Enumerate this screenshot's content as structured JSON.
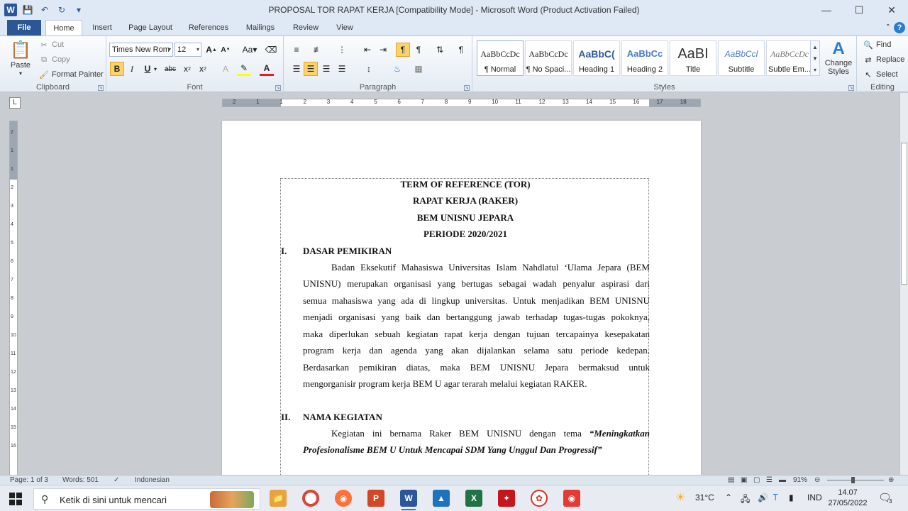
{
  "window": {
    "title": "PROPOSAL TOR RAPAT KERJA [Compatibility Mode]  -  Microsoft Word (Product Activation Failed)"
  },
  "tabs": [
    {
      "label": "File"
    },
    {
      "label": "Home"
    },
    {
      "label": "Insert"
    },
    {
      "label": "Page Layout"
    },
    {
      "label": "References"
    },
    {
      "label": "Mailings"
    },
    {
      "label": "Review"
    },
    {
      "label": "View"
    }
  ],
  "clipboard": {
    "paste": "Paste",
    "cut": "Cut",
    "copy": "Copy",
    "format_painter": "Format Painter",
    "label": "Clipboard"
  },
  "font": {
    "family": "Times New Rom",
    "size": "12",
    "label": "Font"
  },
  "paragraph": {
    "label": "Paragraph"
  },
  "styles": {
    "items": [
      {
        "preview": "AaBbCcDc",
        "name": "¶ Normal"
      },
      {
        "preview": "AaBbCcDc",
        "name": "¶ No Spaci..."
      },
      {
        "preview": "AaBbC(",
        "name": "Heading 1"
      },
      {
        "preview": "AaBbCc",
        "name": "Heading 2"
      },
      {
        "preview": "AaBI",
        "name": "Title"
      },
      {
        "preview": "AaBbCcl",
        "name": "Subtitle"
      },
      {
        "preview": "AaBbCcDc",
        "name": "Subtle Em..."
      }
    ],
    "change_styles": "Change Styles",
    "label": "Styles"
  },
  "editing": {
    "find": "Find",
    "replace": "Replace",
    "select": "Select",
    "label": "Editing"
  },
  "ruler": {
    "numbers": [
      "2",
      "1",
      "1",
      "2",
      "3",
      "4",
      "5",
      "6",
      "7",
      "8",
      "9",
      "10",
      "11",
      "12",
      "13",
      "14",
      "15",
      "16",
      "17",
      "18"
    ]
  },
  "vruler": {
    "numbers": [
      "2",
      "1",
      "1",
      "2",
      "3",
      "4",
      "5",
      "6",
      "7",
      "8",
      "9",
      "10",
      "11",
      "12",
      "13",
      "14",
      "15",
      "16"
    ]
  },
  "document": {
    "headings": [
      "TERM OF REFERENCE (TOR)",
      "RAPAT KERJA (RAKER)",
      "BEM UNISNU JEPARA",
      "PERIODE 2020/2021"
    ],
    "sections": [
      {
        "num": "I.",
        "title": "DASAR PEMIKIRAN",
        "lines": [
          "Badan Eksekutif Mahasiswa  Universitas Islam Nahdlatul  ‘Ulama Jepara (BEM",
          "UNISNU) merupakan organisasi yang bertugas sebagai wadah penyalur aspirasi dari",
          "semua mahasiswa yang ada di lingkup universitas. Untuk menjadikan BEM UNISNU",
          "menjadi organisasi yang baik dan bertanggung jawab terhadap tugas-tugas pokoknya,",
          "maka diperlukan sebuah kegiatan rapat kerja dengan tujuan tercapainya kesepakatan",
          "program kerja dan agenda yang akan dijalankan selama satu periode kedepan.",
          "Berdasarkan pemikiran diatas, maka BEM UNISNU Jepara bermaksud untuk",
          "mengorganisir program kerja BEM U agar terarah melalui kegiatan RAKER."
        ]
      },
      {
        "num": "II.",
        "title": "NAMA KEGIATAN",
        "line1_plain": "Kegiatan ini bernama Raker BEM UNISNU dengan tema ",
        "line1_italic": "“Meningkatkan",
        "line2_italic": "Profesionalisme BEM U Untuk Mencapai SDM Yang Unggul Dan Progressif”"
      }
    ]
  },
  "status": {
    "page": "Page: 1 of 3",
    "words": "Words: 501",
    "language": "Indonesian",
    "zoom": "91%"
  },
  "taskbar": {
    "search_placeholder": "Ketik di sini untuk mencari",
    "weather": "31°C",
    "lang": "IND",
    "time": "14.07",
    "date": "27/05/2022",
    "notif_count": "3"
  },
  "colors": {
    "accent": "#2b579a",
    "file_tab": "#2b5797",
    "highlight": "#fbd36b"
  }
}
